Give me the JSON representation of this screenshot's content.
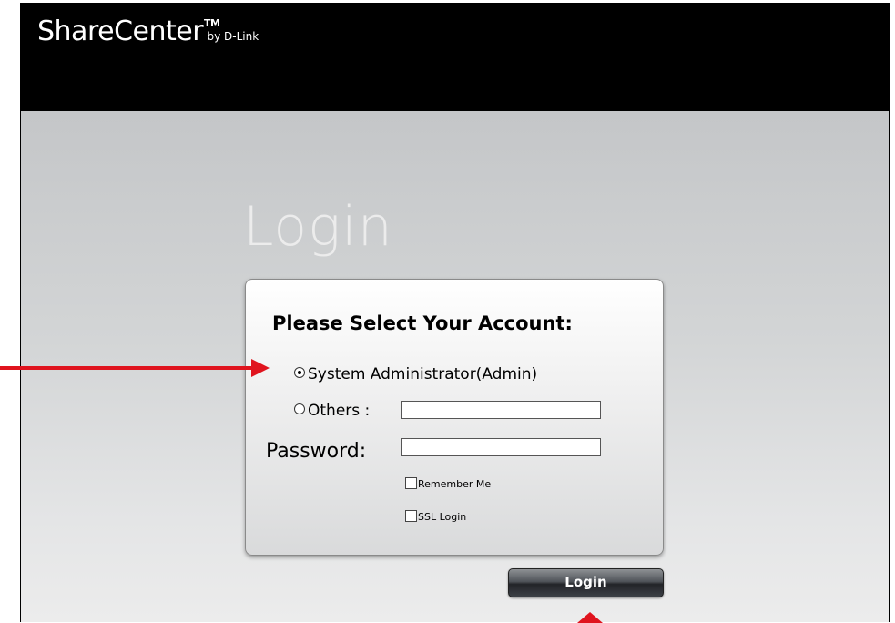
{
  "header": {
    "brand": "ShareCenter",
    "trademark": "TM",
    "byline": "by D-Link"
  },
  "page": {
    "heading": "Login"
  },
  "login_form": {
    "title": "Please Select Your Account:",
    "options": [
      {
        "label": "System Administrator(Admin)",
        "selected": true
      },
      {
        "label": "Others :",
        "selected": false
      }
    ],
    "others_value": "",
    "password_label": "Password:",
    "password_value": "",
    "remember_me_label": "Remember Me",
    "remember_me_checked": false,
    "ssl_login_label": "SSL Login",
    "ssl_login_checked": false,
    "login_button_label": "Login"
  },
  "colors": {
    "annotation_arrow": "#e0141e",
    "header_background": "#000000"
  }
}
